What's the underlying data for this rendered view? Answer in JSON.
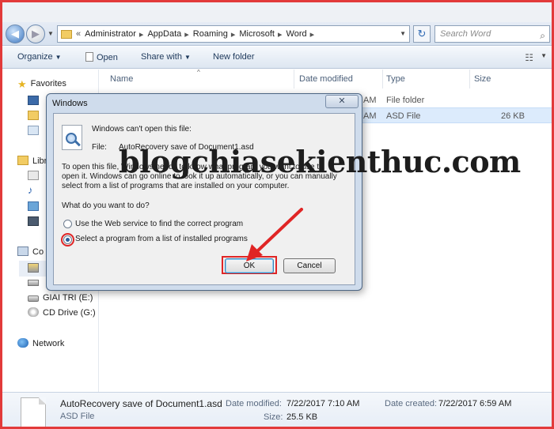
{
  "window": {
    "breadcrumbs": [
      "Administrator",
      "AppData",
      "Roaming",
      "Microsoft",
      "Word"
    ],
    "search_placeholder": "Search Word"
  },
  "toolbar": {
    "organize": "Organize",
    "open": "Open",
    "share_with": "Share with",
    "new_folder": "New folder"
  },
  "nav_pane": {
    "favorites": "Favorites",
    "libraries_partial": "Libr",
    "computer_partial": "Co",
    "drives": [
      "GIAI TRI (E:)",
      "CD Drive (G:)"
    ],
    "network": "Network"
  },
  "file_list": {
    "columns": [
      "Name",
      "Date modified",
      "Type",
      "Size"
    ],
    "rows": [
      {
        "date_tail": "AM",
        "type": "File folder",
        "size": ""
      },
      {
        "date_tail": "AM",
        "type": "ASD File",
        "size": "26 KB"
      }
    ]
  },
  "dialog": {
    "title": "Windows",
    "close_glyph": "✕",
    "heading": "Windows can't open this file:",
    "file_label": "File:",
    "file_name": "AutoRecovery save of Document1.asd",
    "explain_1": "To open this file, Windows needs to know what program you want to use to",
    "explain_2": "open it. Windows can go online to look it up automatically, or you can manually",
    "explain_3": "select from a list of programs that are installed on your computer.",
    "question": "What do you want to do?",
    "option_web": "Use the Web service to find the correct program",
    "option_list": "Select a program from a list of installed programs",
    "selected_option": "option_list",
    "ok": "OK",
    "cancel": "Cancel"
  },
  "watermark": "blogchiasekienthuc.com",
  "details": {
    "file_name": "AutoRecovery save of Document1.asd",
    "file_type": "ASD File",
    "date_modified_label": "Date modified:",
    "date_modified": "7/22/2017 7:10 AM",
    "size_label": "Size:",
    "size": "25.5 KB",
    "date_created_label": "Date created:",
    "date_created": "7/22/2017 6:59 AM"
  },
  "colors": {
    "annotation_red": "#e02525",
    "selection_blue": "#dcebfc"
  }
}
